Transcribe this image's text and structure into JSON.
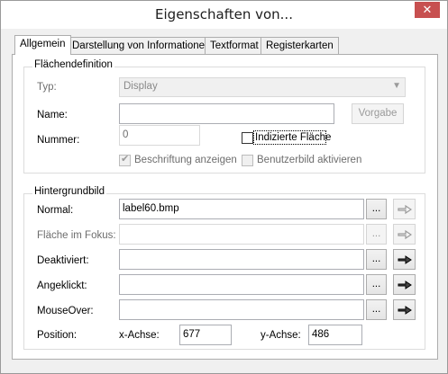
{
  "window": {
    "title": "Eigenschaften von...",
    "close_glyph": "✕"
  },
  "tabs": [
    {
      "label": "Allgemein",
      "active": true
    },
    {
      "label": "Darstellung von Informationen",
      "active": false
    },
    {
      "label": "Textformat",
      "active": false
    },
    {
      "label": "Registerkarten",
      "active": false
    }
  ],
  "flaechendefinition": {
    "group_label": "Flächendefinition",
    "typ_label": "Typ:",
    "typ_value": "Display",
    "name_label": "Name:",
    "name_value": "",
    "vorgabe_button": "Vorgabe",
    "nummer_label": "Nummer:",
    "nummer_value": "0",
    "indizierte_label": "Indizierte Fläche",
    "indizierte_checked": false,
    "beschriftung_label": "Beschriftung anzeigen",
    "beschriftung_checked": true,
    "benutzerbild_label": "Benutzerbild aktivieren",
    "benutzerbild_checked": false
  },
  "hintergrundbild": {
    "group_label": "Hintergrundbild",
    "browse_label": "...",
    "rows": [
      {
        "label": "Normal:",
        "value": "label60.bmp",
        "enabled": true
      },
      {
        "label": "Fläche im Fokus:",
        "value": "",
        "enabled": false
      },
      {
        "label": "Deaktiviert:",
        "value": "",
        "enabled": true
      },
      {
        "label": "Angeklickt:",
        "value": "",
        "enabled": true
      },
      {
        "label": "MouseOver:",
        "value": "",
        "enabled": true
      }
    ],
    "position_label": "Position:",
    "x_label": "x-Achse:",
    "x_value": "677",
    "y_label": "y-Achse:",
    "y_value": "486"
  },
  "icons": {
    "pick": "pointing-hand-icon",
    "check": "✔",
    "dropdown": "▼"
  }
}
